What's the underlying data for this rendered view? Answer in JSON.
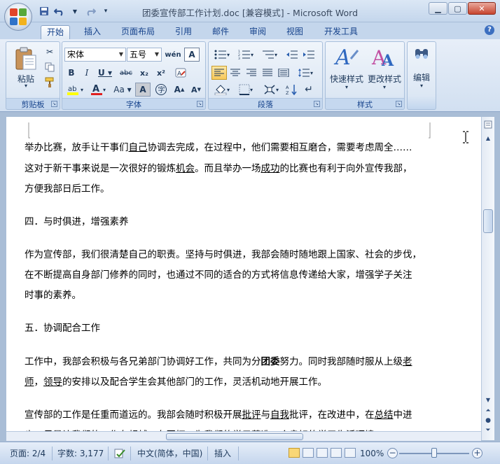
{
  "window": {
    "title": "团委宣传部工作计划.doc [兼容模式] - Microsoft Word",
    "controls": [
      "minimize-icon",
      "maximize-icon",
      "close-icon"
    ]
  },
  "quick_access": [
    "save-icon",
    "undo-icon",
    "redo-icon",
    "customize-icon"
  ],
  "tabs": [
    "开始",
    "插入",
    "页面布局",
    "引用",
    "邮件",
    "审阅",
    "视图",
    "开发工具"
  ],
  "active_tab": "开始",
  "ribbon": {
    "clipboard": {
      "label": "剪贴板",
      "paste": "粘贴"
    },
    "font": {
      "label": "字体",
      "name": "宋体",
      "size": "五号"
    },
    "paragraph": {
      "label": "段落"
    },
    "styles": {
      "label": "样式",
      "quick": "快速样式",
      "change": "更改样式"
    },
    "editing": {
      "label": "编辑"
    }
  },
  "document": {
    "paragraphs": [
      [
        "举办比赛，放手让干事们",
        {
          "u": "自己"
        },
        "协调去完成，在过程中，他们需要相互磨合，需要考虑周全……"
      ],
      [
        "这对于新干事来说是一次很好的锻炼",
        {
          "u": "机会"
        },
        "。而且举办一场",
        {
          "u": "成功"
        },
        "的比赛也有利于向外宣传我部，"
      ],
      [
        "方便我部日后工作。"
      ],
      [
        "四．与时俱进，增强素养"
      ],
      [
        "作为宣传部，我们很清楚自己的职责。坚持与时俱进，我部会随时随地跟上国家、社会的步伐，"
      ],
      [
        "在不断提高自身部门修养的同时，也通过不同的适合的方式将信息传递给大家，增强学子关注"
      ],
      [
        "时事的素养。"
      ],
      [
        "五．协调配合工作"
      ],
      [
        "工作中，我部会积极与各兄弟部门协调好工作，共同为分",
        {
          "b": "团委"
        },
        "努力。同时我部随时服从上级",
        {
          "u": "老"
        }
      ],
      [
        {
          "u": "师"
        },
        "，",
        {
          "u": "领导"
        },
        "的安排以及配合学生会其他部门的工作，灵活机动地开展工作。"
      ],
      [
        "宣传部的工作是任重而道远的。我部会随时积极开展",
        {
          "u": "批评"
        },
        "与",
        {
          "u": "自我"
        },
        "批评，在改进中，在",
        {
          "u": "总结"
        },
        "中进"
      ],
      [
        "步，尽量让我们的工作有超越、有开拓，为我们的学子营造一个良好的学习生活环境。"
      ]
    ]
  },
  "status": {
    "page": "页面: 2/4",
    "words": "字数: 3,177",
    "language": "中文(简体，中国)",
    "mode": "插入",
    "zoom": "100%",
    "zoom_level": 100
  }
}
